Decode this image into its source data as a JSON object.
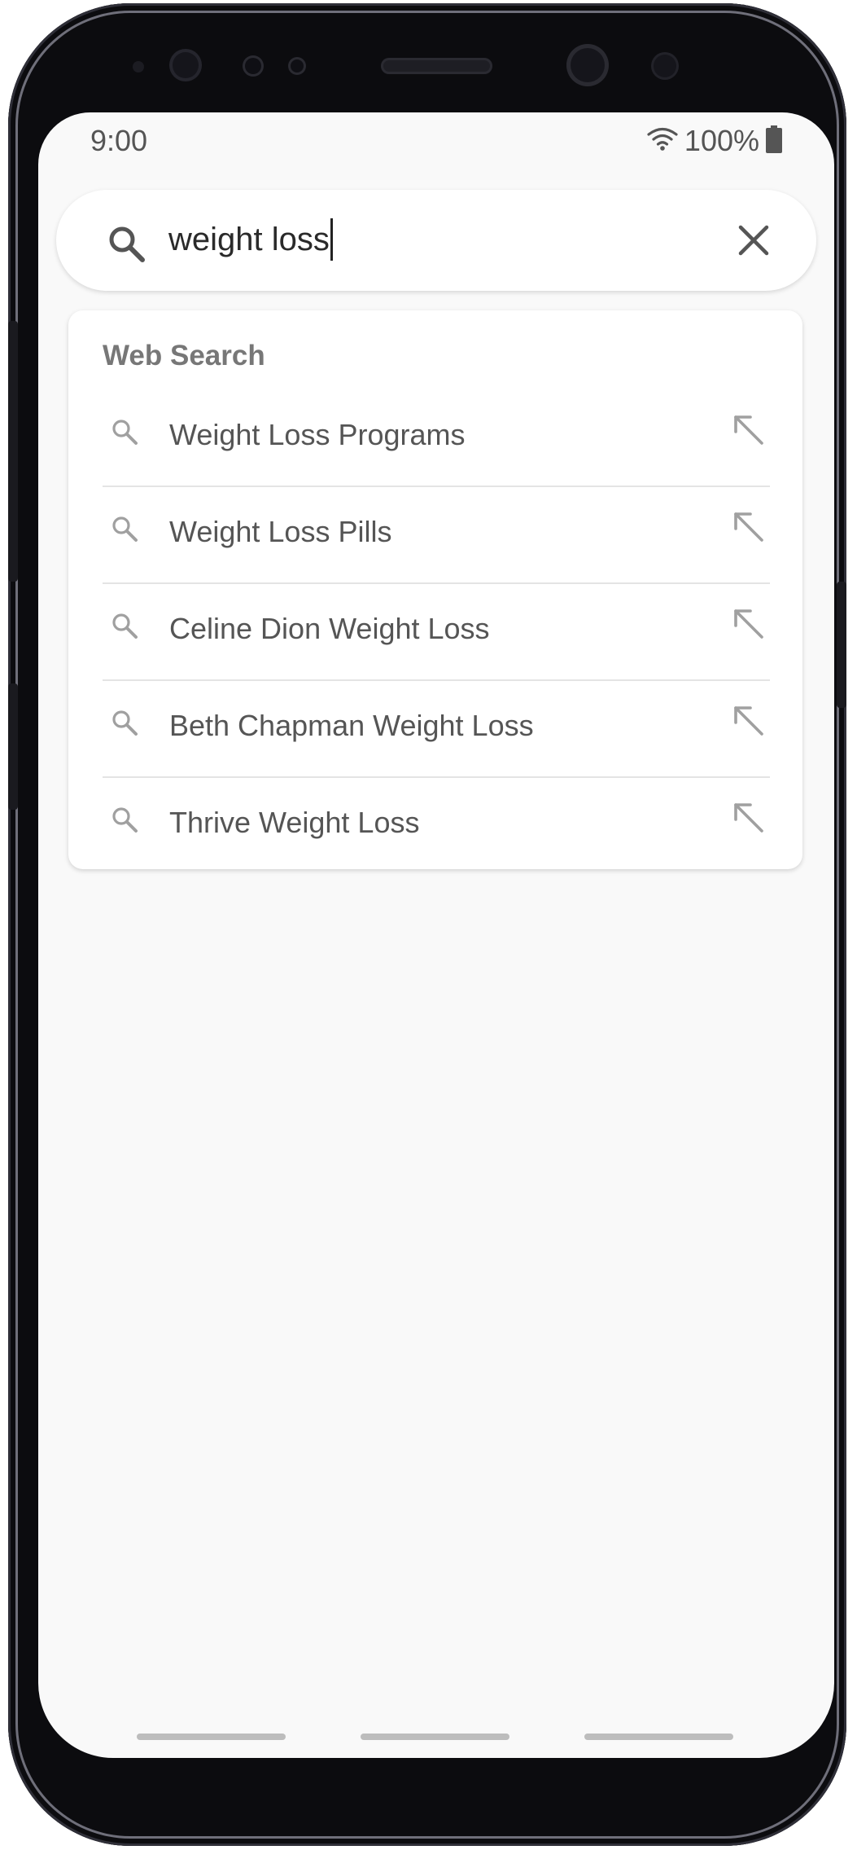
{
  "status_bar": {
    "time": "9:00",
    "battery_percent": "100%",
    "wifi_icon": "wifi-icon",
    "battery_icon": "battery-icon"
  },
  "search": {
    "query": "weight loss",
    "search_icon": "search-icon",
    "clear_icon": "close-icon"
  },
  "suggestions": {
    "header": "Web Search",
    "items": [
      {
        "label": "Weight Loss Programs",
        "icon": "search-icon",
        "action_icon": "arrow-up-left-icon"
      },
      {
        "label": "Weight Loss Pills",
        "icon": "search-icon",
        "action_icon": "arrow-up-left-icon"
      },
      {
        "label": "Celine Dion Weight Loss",
        "icon": "search-icon",
        "action_icon": "arrow-up-left-icon"
      },
      {
        "label": "Beth Chapman Weight Loss",
        "icon": "search-icon",
        "action_icon": "arrow-up-left-icon"
      },
      {
        "label": "Thrive Weight Loss",
        "icon": "search-icon",
        "action_icon": "arrow-up-left-icon"
      }
    ]
  },
  "colors": {
    "screen_background": "#f9f9f9",
    "card_background": "#ffffff",
    "text_primary": "#2a2a2a",
    "text_secondary": "#555555",
    "header_text": "#777777",
    "icon_gray": "#a0a0a0",
    "divider": "#e4e4e4"
  }
}
